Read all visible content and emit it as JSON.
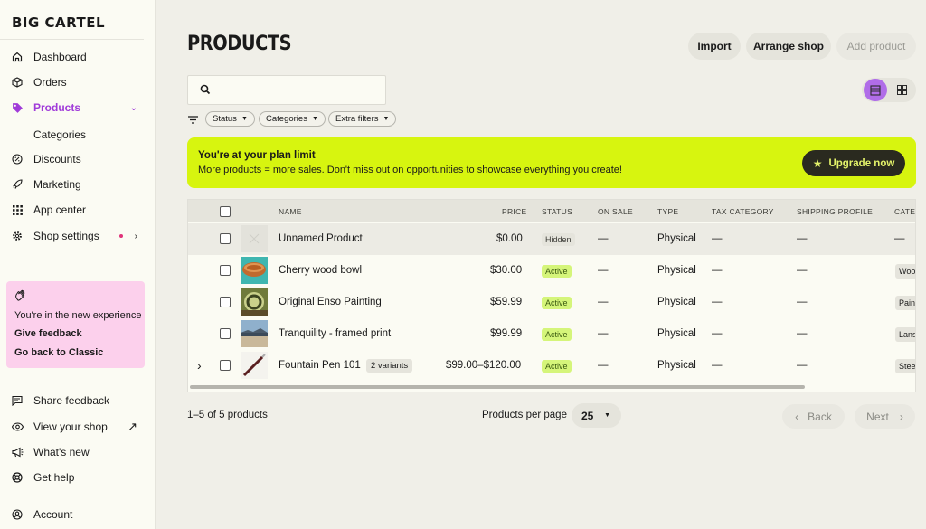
{
  "brand": "BIG CARTEL",
  "sidebar": {
    "items": [
      {
        "label": "Dashboard",
        "icon": "home-icon"
      },
      {
        "label": "Orders",
        "icon": "box-icon"
      },
      {
        "label": "Products",
        "icon": "tag-icon"
      },
      {
        "label": "Categories"
      },
      {
        "label": "Discounts",
        "icon": "discount-icon"
      },
      {
        "label": "Marketing",
        "icon": "rocket-icon"
      },
      {
        "label": "App center",
        "icon": "grid-icon"
      },
      {
        "label": "Shop settings",
        "icon": "gear-icon"
      }
    ],
    "promo": {
      "text": "You're in the new experience",
      "feedback": "Give feedback",
      "classic": "Go back to Classic"
    },
    "bottom": [
      {
        "label": "Share feedback",
        "icon": "chat-icon"
      },
      {
        "label": "View your shop",
        "icon": "eye-icon"
      },
      {
        "label": "What's new",
        "icon": "megaphone-icon"
      },
      {
        "label": "Get help",
        "icon": "lifebuoy-icon"
      },
      {
        "label": "Account",
        "icon": "user-icon"
      }
    ]
  },
  "header": {
    "title": "PRODUCTS",
    "import": "Import",
    "arrange": "Arrange shop",
    "add": "Add product"
  },
  "filters": {
    "status": "Status",
    "categories": "Categories",
    "extra": "Extra filters"
  },
  "banner": {
    "title": "You're at your plan limit",
    "message": "More products = more sales. Don't miss out on opportunities to showcase everything you create!",
    "button": "Upgrade now"
  },
  "table": {
    "columns": [
      "NAME",
      "PRICE",
      "STATUS",
      "ON SALE",
      "TYPE",
      "TAX CATEGORY",
      "SHIPPING PROFILE",
      "CATEG"
    ],
    "rows": [
      {
        "name": "Unnamed Product",
        "price": "$0.00",
        "status": "Hidden",
        "on_sale": "—",
        "type": "Physical",
        "tax": "—",
        "shipping": "—",
        "category": "—"
      },
      {
        "name": "Cherry wood bowl",
        "price": "$30.00",
        "status": "Active",
        "on_sale": "—",
        "type": "Physical",
        "tax": "—",
        "shipping": "—",
        "category": "Wood"
      },
      {
        "name": "Original Enso Painting",
        "price": "$59.99",
        "status": "Active",
        "on_sale": "—",
        "type": "Physical",
        "tax": "—",
        "shipping": "—",
        "category": "Paint"
      },
      {
        "name": "Tranquility - framed print",
        "price": "$99.99",
        "status": "Active",
        "on_sale": "—",
        "type": "Physical",
        "tax": "—",
        "shipping": "—",
        "category": "Lans"
      },
      {
        "name": "Fountain Pen 101",
        "variants": "2 variants",
        "price": "$99.00–$120.00",
        "status": "Active",
        "on_sale": "—",
        "type": "Physical",
        "tax": "—",
        "shipping": "—",
        "category": "Stee"
      }
    ]
  },
  "pagination": {
    "count": "1–5 of 5 products",
    "per_page_label": "Products per page",
    "per_page": "25",
    "back": "Back",
    "next": "Next"
  },
  "colors": {
    "accent": "#a03bd9",
    "banner": "#d7f50f",
    "promo": "#fcd0ec"
  }
}
